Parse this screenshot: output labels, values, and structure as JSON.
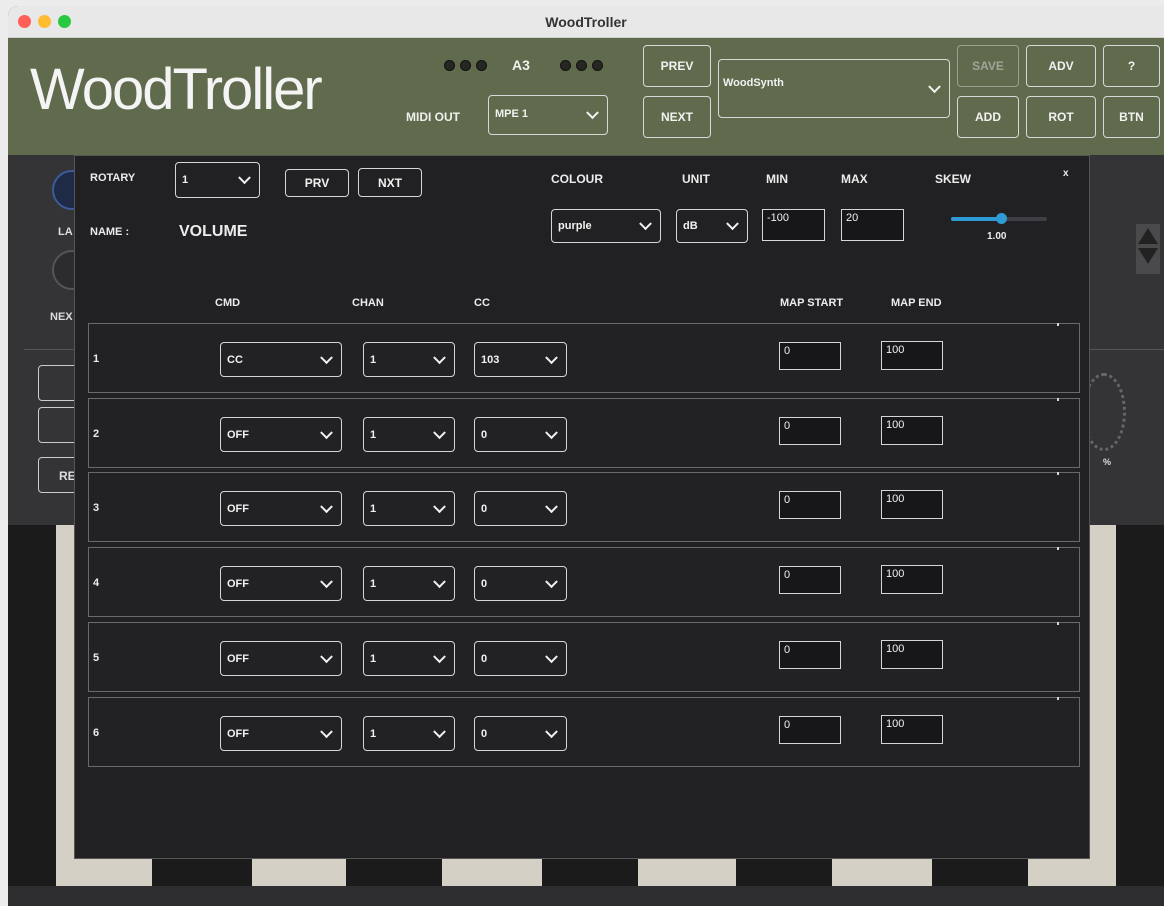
{
  "window": {
    "title": "WoodTroller"
  },
  "header": {
    "logo": "WoodTroller",
    "note": "A3",
    "midi_out_label": "MIDI OUT",
    "midi_out_value": "MPE 1",
    "prev_label": "PREV",
    "next_label": "NEXT",
    "preset_value": "WoodSynth",
    "buttons": {
      "save": "SAVE",
      "adv": "ADV",
      "help": "?",
      "add": "ADD",
      "rot": "ROT",
      "btn": "BTN"
    }
  },
  "background": {
    "partial_labels": [
      "LA",
      "NEX",
      "RE",
      "%"
    ]
  },
  "modal": {
    "close_label": "x",
    "rotary_label": "ROTARY",
    "rotary_value": "1",
    "prv_label": "PRV",
    "nxt_label": "NXT",
    "colour_label": "COLOUR",
    "colour_value": "purple",
    "unit_label": "UNIT",
    "unit_value": "dB",
    "min_label": "MIN",
    "min_value": "-100",
    "max_label": "MAX",
    "max_value": "20",
    "skew_label": "SKEW",
    "skew_value": "1.00",
    "name_label": "NAME :",
    "name_value": "VOLUME",
    "columns": {
      "cmd": "CMD",
      "chan": "CHAN",
      "cc": "CC",
      "map_start": "MAP START",
      "map_end": "MAP END"
    },
    "rows": [
      {
        "num": "1",
        "cmd": "CC",
        "chan": "1",
        "cc": "103",
        "map_start": "0",
        "map_end": "100"
      },
      {
        "num": "2",
        "cmd": "OFF",
        "chan": "1",
        "cc": "0",
        "map_start": "0",
        "map_end": "100"
      },
      {
        "num": "3",
        "cmd": "OFF",
        "chan": "1",
        "cc": "0",
        "map_start": "0",
        "map_end": "100"
      },
      {
        "num": "4",
        "cmd": "OFF",
        "chan": "1",
        "cc": "0",
        "map_start": "0",
        "map_end": "100"
      },
      {
        "num": "5",
        "cmd": "OFF",
        "chan": "1",
        "cc": "0",
        "map_start": "0",
        "map_end": "100"
      },
      {
        "num": "6",
        "cmd": "OFF",
        "chan": "1",
        "cc": "0",
        "map_start": "0",
        "map_end": "100"
      }
    ]
  },
  "colors": {
    "header_bg": "#5f6b4c",
    "modal_bg": "#212124",
    "skew_accent": "#2f9bd6"
  }
}
